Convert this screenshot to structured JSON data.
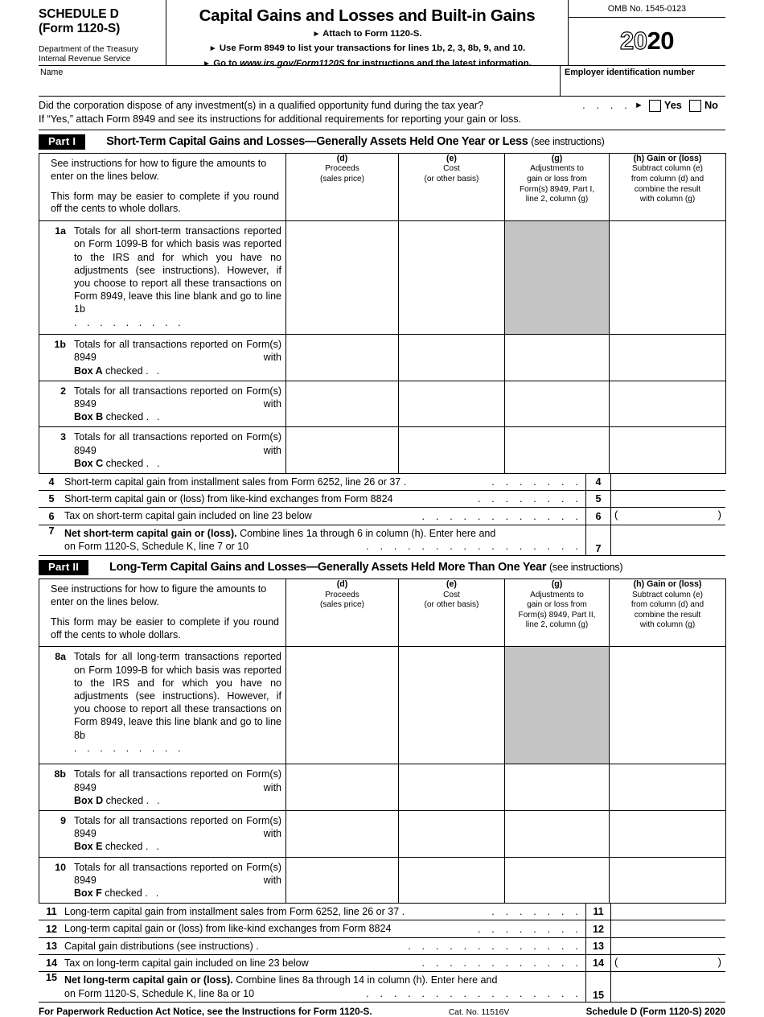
{
  "header": {
    "schedule_line1": "SCHEDULE D",
    "schedule_line2": "(Form 1120-S)",
    "dept_line1": "Department of the Treasury",
    "dept_line2": "Internal Revenue Service",
    "form_title": "Capital Gains and Losses and Built-in Gains",
    "attach_line": "Attach to Form 1120-S.",
    "use_line": "Use Form 8949 to list your transactions for lines 1b, 2, 3, 8b, 9, and 10.",
    "goto_prefix": "Go to ",
    "goto_url": "www.irs.gov/Form1120S",
    "goto_suffix": " for instructions and the latest information.",
    "omb": "OMB No. 1545-0123",
    "year_outline": "20",
    "year_bold": "20"
  },
  "identity": {
    "name_label": "Name",
    "name_value": "",
    "ein_label": "Employer identification number",
    "ein_value": ""
  },
  "question": {
    "text": "Did the corporation dispose of any investment(s) in a qualified opportunity fund during the tax year?",
    "dots": ". . . .",
    "yes_label": "Yes",
    "no_label": "No",
    "followup": "If “Yes,” attach Form 8949 and see its instructions for additional requirements for reporting your gain or loss."
  },
  "part1": {
    "tag": "Part I",
    "heading": "Short-Term Capital Gains and Losses—Generally Assets Held One Year or Less",
    "heading_note": "(see instructions)",
    "instructions_p1": "See instructions for how to figure the amounts to enter on the lines below.",
    "instructions_p2": "This form may be easier to complete if you round off the cents to whole dollars.",
    "columns": [
      {
        "code": "(d)",
        "l1": "Proceeds",
        "l2": "(sales price)",
        "l3": "",
        "l4": ""
      },
      {
        "code": "(e)",
        "l1": "Cost",
        "l2": "(or other basis)",
        "l3": "",
        "l4": ""
      },
      {
        "code": "(g)",
        "l1": "Adjustments to",
        "l2": "gain or loss from",
        "l3": "Form(s) 8949, Part I,",
        "l4": "line 2, column (g)"
      },
      {
        "code": "(h) Gain or (loss)",
        "l1": "Subtract column (e)",
        "l2": "from column (d) and",
        "l3": "combine the result",
        "l4": "with column (g)"
      }
    ],
    "rows": [
      {
        "no": "1a",
        "text": "Totals for all short-term transactions reported on Form 1099-B for which basis was reported to the IRS and for which you have no adjustments (see instructions). However, if you choose to report all these transactions on Form 8949, leave this line blank and go to line 1b",
        "dots": ". . . . . . . . .",
        "d": "",
        "e": "",
        "g": "",
        "h": ""
      },
      {
        "no": "1b",
        "text": "Totals for all transactions reported on Form(s) 8949 with ",
        "bold": "Box A",
        "text2": " checked .",
        "dots": ".",
        "d": "",
        "e": "",
        "g": "",
        "h": ""
      },
      {
        "no": "2",
        "text": "Totals for all transactions reported on Form(s) 8949 with ",
        "bold": "Box B",
        "text2": " checked .",
        "dots": ".",
        "d": "",
        "e": "",
        "g": "",
        "h": ""
      },
      {
        "no": "3",
        "text": "Totals for all transactions reported on Form(s) 8949 with ",
        "bold": "Box C",
        "text2": " checked .",
        "dots": ".",
        "d": "",
        "e": "",
        "g": "",
        "h": ""
      }
    ],
    "summary": [
      {
        "no": "4",
        "text": "Short-term capital gain from installment sales from Form 6252, line 26 or 37 .",
        "dots": ". . . . . . .",
        "box": "4",
        "value": "",
        "paren": false
      },
      {
        "no": "5",
        "text": "Short-term capital gain or (loss) from like-kind exchanges from Form 8824",
        "dots": ". . . . . . . .",
        "box": "5",
        "value": "",
        "paren": false
      },
      {
        "no": "6",
        "text": "Tax on short-term capital gain included on line 23 below",
        "dots": ". . . . . . . . . . . .",
        "box": "6",
        "value": "",
        "paren": true
      }
    ],
    "line7": {
      "no": "7",
      "bold": "Net short-term capital gain or (loss).",
      "text": " Combine lines 1a through 6 in column (h). Enter here and",
      "line2": "on Form 1120-S,  Schedule K, line 7 or 10",
      "dots": ". . . . . . . . . . . . . . . .",
      "box": "7",
      "value": ""
    }
  },
  "part2": {
    "tag": "Part II",
    "heading": "Long-Term Capital Gains and Losses—Generally Assets Held More Than One Year",
    "heading_note": "(see instructions)",
    "instructions_p1": "See instructions for how to figure the amounts to enter on the lines below.",
    "instructions_p2": "This form may be easier to complete if you round off the cents to whole dollars.",
    "columns": [
      {
        "code": "(d)",
        "l1": "Proceeds",
        "l2": "(sales price)",
        "l3": "",
        "l4": ""
      },
      {
        "code": "(e)",
        "l1": "Cost",
        "l2": "(or other basis)",
        "l3": "",
        "l4": ""
      },
      {
        "code": "(g)",
        "l1": "Adjustments to",
        "l2": "gain or loss from",
        "l3": "Form(s) 8949, Part II,",
        "l4": "line 2, column (g)"
      },
      {
        "code": "(h) Gain or (loss)",
        "l1": "Subtract column (e)",
        "l2": "from column (d) and",
        "l3": "combine the result",
        "l4": "with column (g)"
      }
    ],
    "rows": [
      {
        "no": "8a",
        "text": "Totals for all long-term transactions reported on Form 1099-B for which basis was reported to the IRS and for which you have no adjustments (see instructions). However, if you choose to report all these transactions on Form 8949, leave this line blank and go to line 8b",
        "dots": ". . . . . . . . .",
        "d": "",
        "e": "",
        "g": "",
        "h": ""
      },
      {
        "no": "8b",
        "text": "Totals for all transactions reported on Form(s) 8949 with ",
        "bold": "Box D",
        "text2": " checked .",
        "dots": ".",
        "d": "",
        "e": "",
        "g": "",
        "h": ""
      },
      {
        "no": "9",
        "text": "Totals for all transactions reported on Form(s) 8949 with ",
        "bold": "Box E",
        "text2": " checked .",
        "dots": ".",
        "d": "",
        "e": "",
        "g": "",
        "h": ""
      },
      {
        "no": "10",
        "text": "Totals for all transactions reported on Form(s) 8949 with ",
        "bold": "Box F",
        "text2": " checked .",
        "dots": ".",
        "d": "",
        "e": "",
        "g": "",
        "h": ""
      }
    ],
    "summary": [
      {
        "no": "11",
        "text": "Long-term capital gain from installment sales from Form 6252, line 26 or 37 .",
        "dots": ". . . . . . .",
        "box": "11",
        "value": "",
        "paren": false
      },
      {
        "no": "12",
        "text": "Long-term capital gain or (loss) from like-kind exchanges from Form 8824",
        "dots": ". . . . . . . .",
        "box": "12",
        "value": "",
        "paren": false
      },
      {
        "no": "13",
        "text": "Capital gain distributions (see instructions) .",
        "dots": ". . . . . . . . . . . . .",
        "box": "13",
        "value": "",
        "paren": false
      },
      {
        "no": "14",
        "text": "Tax on long-term capital gain included on line 23 below",
        "dots": ". . . . . . . . . . . .",
        "box": "14",
        "value": "",
        "paren": true
      }
    ],
    "line15": {
      "no": "15",
      "bold": "Net long-term capital gain or (loss).",
      "text": " Combine lines 8a through 14 in column (h). Enter here and",
      "line2": "on Form 1120-S, Schedule K, line 8a or 10",
      "dots": ". . . . . . . . . . . . . . . .",
      "box": "15",
      "value": ""
    }
  },
  "footer": {
    "left": "For Paperwork Reduction Act Notice, see the Instructions for Form 1120-S.",
    "cat": "Cat. No. 11516V",
    "right": "Schedule D (Form 1120-S) 2020"
  }
}
